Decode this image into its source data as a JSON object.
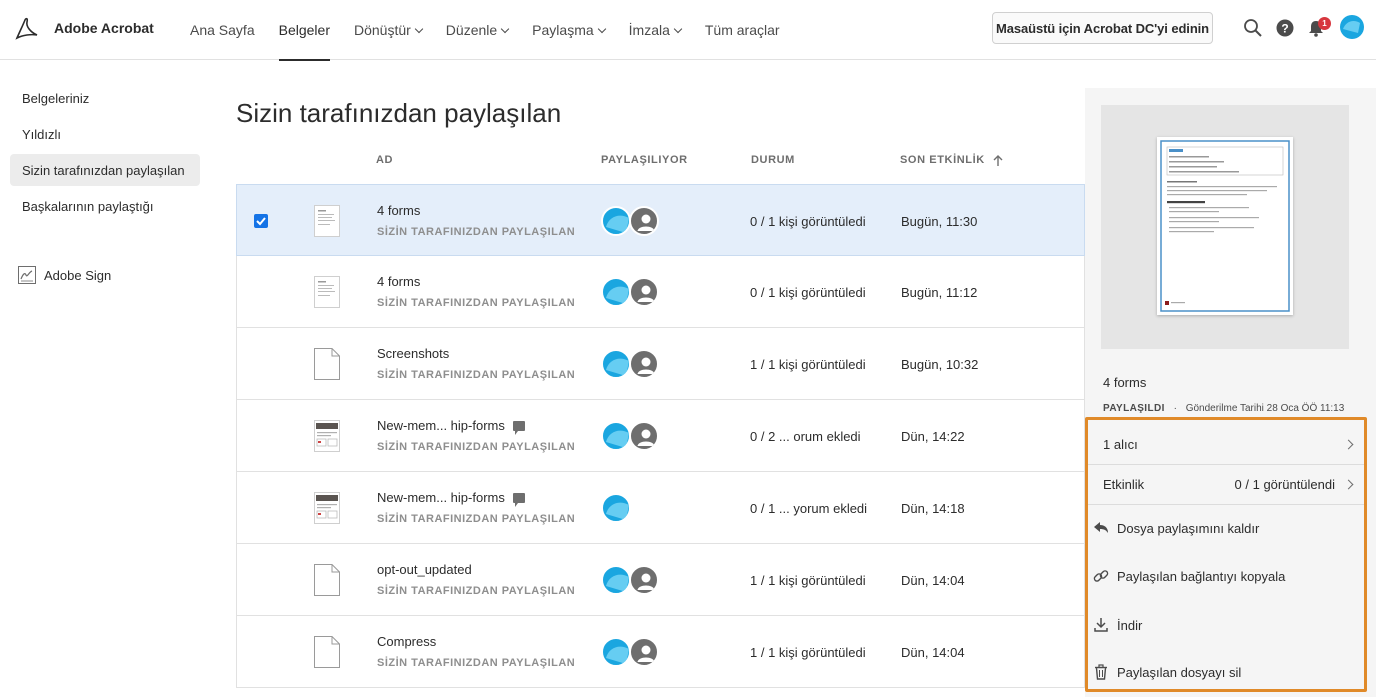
{
  "app": {
    "brand": "Adobe Acrobat"
  },
  "nav": {
    "items": [
      {
        "label": "Ana Sayfa",
        "dropdown": false,
        "active": false
      },
      {
        "label": "Belgeler",
        "dropdown": false,
        "active": true
      },
      {
        "label": "Dönüştür",
        "dropdown": true,
        "active": false
      },
      {
        "label": "Düzenle",
        "dropdown": true,
        "active": false
      },
      {
        "label": "Paylaşma",
        "dropdown": true,
        "active": false
      },
      {
        "label": "İmzala",
        "dropdown": true,
        "active": false
      },
      {
        "label": "Tüm araçlar",
        "dropdown": false,
        "active": false
      }
    ],
    "promo_button": "Masaüstü için Acrobat DC'yi edinin",
    "notification_count": "1"
  },
  "sidebar": {
    "items": [
      {
        "label": "Belgeleriniz"
      },
      {
        "label": "Yıldızlı"
      },
      {
        "label": "Sizin tarafınızdan paylaşılan"
      },
      {
        "label": "Başkalarının paylaştığı"
      }
    ],
    "sign_label": "Adobe Sign"
  },
  "main": {
    "title": "Sizin tarafınızdan paylaşılan",
    "columns": {
      "name": "AD",
      "sharing": "PAYLAŞILIYOR",
      "status": "DURUM",
      "activity": "SON ETKİNLİK"
    },
    "rows": [
      {
        "name": "4 forms",
        "sub": "SİZİN TARAFINIZDAN PAYLAŞILAN",
        "status": "0 / 1 kişi görüntüledi",
        "activity": "Bugün, 11:30",
        "thumb": "doc",
        "comment": false,
        "recipients": 2,
        "selected": true
      },
      {
        "name": "4 forms",
        "sub": "SİZİN TARAFINIZDAN PAYLAŞILAN",
        "status": "0 / 1 kişi görüntüledi",
        "activity": "Bugün, 11:12",
        "thumb": "doc",
        "comment": false,
        "recipients": 2,
        "selected": false
      },
      {
        "name": "Screenshots",
        "sub": "SİZİN TARAFINIZDAN PAYLAŞILAN",
        "status": "1 / 1 kişi görüntüledi",
        "activity": "Bugün, 10:32",
        "thumb": "blank",
        "comment": false,
        "recipients": 2,
        "selected": false
      },
      {
        "name": "New-mem... hip-forms",
        "sub": "SİZİN TARAFINIZDAN PAYLAŞILAN",
        "status": "0 / 2 ... orum ekledi",
        "activity": "Dün, 14:22",
        "thumb": "form",
        "comment": true,
        "recipients": 2,
        "selected": false
      },
      {
        "name": "New-mem... hip-forms",
        "sub": "SİZİN TARAFINIZDAN PAYLAŞILAN",
        "status": "0 / 1 ... yorum ekledi",
        "activity": "Dün, 14:18",
        "thumb": "form",
        "comment": true,
        "recipients": 1,
        "selected": false
      },
      {
        "name": "opt-out_updated",
        "sub": "SİZİN TARAFINIZDAN PAYLAŞILAN",
        "status": "1 / 1 kişi görüntüledi",
        "activity": "Dün, 14:04",
        "thumb": "blank",
        "comment": false,
        "recipients": 2,
        "selected": false
      },
      {
        "name": "Compress",
        "sub": "SİZİN TARAFINIZDAN PAYLAŞILAN",
        "status": "1 / 1 kişi görüntüledi",
        "activity": "Dün, 14:04",
        "thumb": "blank",
        "comment": false,
        "recipients": 2,
        "selected": false
      }
    ]
  },
  "panel": {
    "file_name": "4 forms",
    "meta_label": "PAYLAŞILDI",
    "meta_date": "Gönderilme Tarihi 28 Oca ÖÖ 11:13",
    "recipients_label": "1 alıcı",
    "activity_label": "Etkinlik",
    "activity_value": "0 / 1 görüntülendi",
    "actions": {
      "unshare": "Dosya paylaşımını kaldır",
      "copy_link": "Paylaşılan bağlantıyı kopyala",
      "download": "İndir",
      "delete": "Paylaşılan dosyayı sil"
    }
  },
  "colors": {
    "accent": "#1473e6",
    "highlight": "#e08a29",
    "selected_row": "#e4eefa",
    "avatar": "#1aa6e0"
  }
}
